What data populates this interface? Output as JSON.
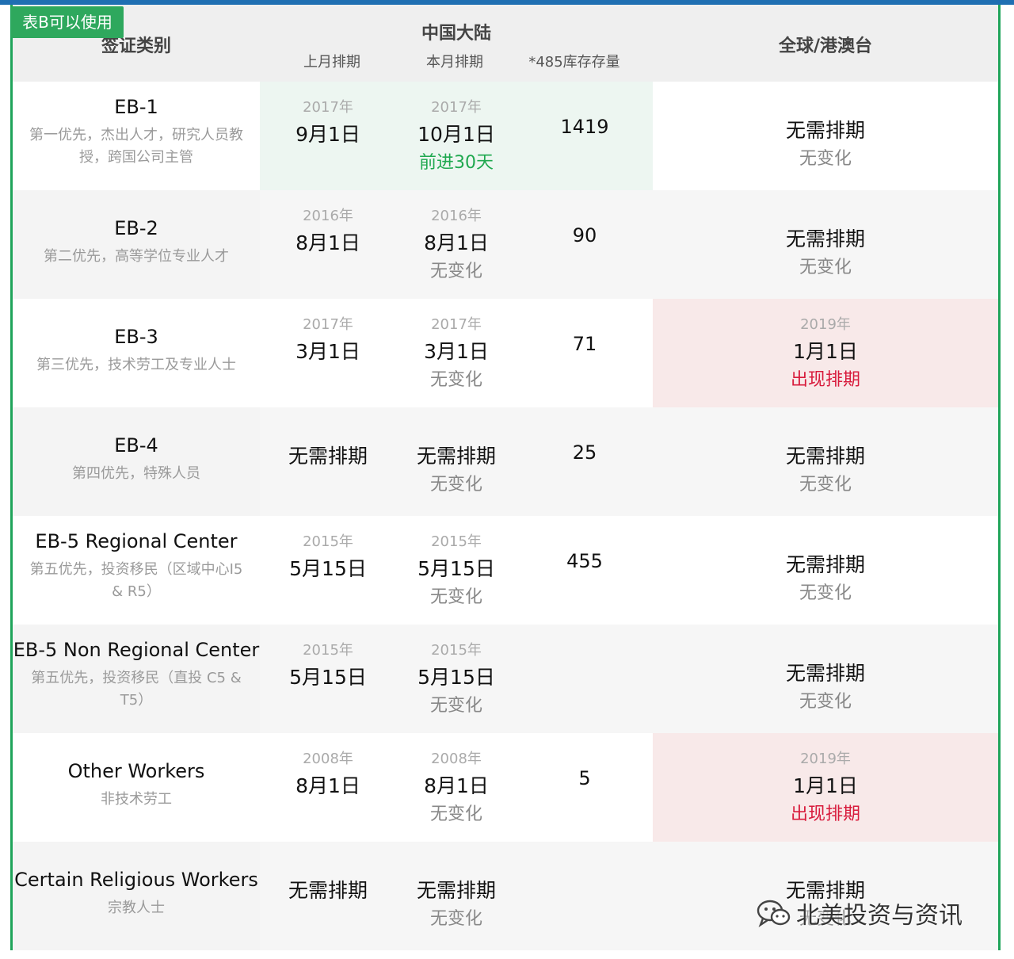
{
  "badge": "表B可以使用",
  "header": {
    "category": "签证类别",
    "china": "中国大陆",
    "last_month": "上月排期",
    "this_month": "本月排期",
    "inventory": "*485库存存量",
    "global": "全球/港澳台"
  },
  "rows": [
    {
      "name": "EB-1",
      "desc": "第一优先，杰出人才，研究人员教授，跨国公司主管",
      "last_year": "2017年",
      "last_date": "9月1日",
      "this_year": "2017年",
      "this_date": "10月1日",
      "this_note": "前进30天",
      "inventory": "1419",
      "glob_year": "",
      "glob_date": "无需排期",
      "glob_note": "无变化"
    },
    {
      "name": "EB-2",
      "desc": "第二优先，高等学位专业人才",
      "last_year": "2016年",
      "last_date": "8月1日",
      "this_year": "2016年",
      "this_date": "8月1日",
      "this_note": "无变化",
      "inventory": "90",
      "glob_year": "",
      "glob_date": "无需排期",
      "glob_note": "无变化"
    },
    {
      "name": "EB-3",
      "desc": "第三优先，技术劳工及专业人士",
      "last_year": "2017年",
      "last_date": "3月1日",
      "this_year": "2017年",
      "this_date": "3月1日",
      "this_note": "无变化",
      "inventory": "71",
      "glob_year": "2019年",
      "glob_date": "1月1日",
      "glob_note": "出现排期"
    },
    {
      "name": "EB-4",
      "desc": "第四优先，特殊人员",
      "last_year": "",
      "last_date": "无需排期",
      "this_year": "",
      "this_date": "无需排期",
      "this_note": "无变化",
      "inventory": "25",
      "glob_year": "",
      "glob_date": "无需排期",
      "glob_note": "无变化"
    },
    {
      "name": "EB-5 Regional Center",
      "desc": "第五优先，投资移民（区域中心I5 & R5）",
      "last_year": "2015年",
      "last_date": "5月15日",
      "this_year": "2015年",
      "this_date": "5月15日",
      "this_note": "无变化",
      "inventory": "455",
      "glob_year": "",
      "glob_date": "无需排期",
      "glob_note": "无变化"
    },
    {
      "name": "EB-5 Non Regional Center",
      "desc": "第五优先，投资移民（直投 C5 & T5）",
      "last_year": "2015年",
      "last_date": "5月15日",
      "this_year": "2015年",
      "this_date": "5月15日",
      "this_note": "无变化",
      "inventory": "",
      "glob_year": "",
      "glob_date": "无需排期",
      "glob_note": "无变化"
    },
    {
      "name": "Other Workers",
      "desc": "非技术劳工",
      "last_year": "2008年",
      "last_date": "8月1日",
      "this_year": "2008年",
      "this_date": "8月1日",
      "this_note": "无变化",
      "inventory": "5",
      "glob_year": "2019年",
      "glob_date": "1月1日",
      "glob_note": "出现排期"
    },
    {
      "name": "Certain Religious Workers",
      "desc": "宗教人士",
      "last_year": "",
      "last_date": "无需排期",
      "this_year": "",
      "this_date": "无需排期",
      "this_note": "无变化",
      "inventory": "",
      "glob_year": "",
      "glob_date": "无需排期",
      "glob_note": "无变化"
    }
  ],
  "watermark": "北美投资与资讯",
  "colors": {
    "green": "#1fa84f",
    "red": "#d81b3c",
    "badge": "#2ea85d",
    "frame": "#1fa45a"
  }
}
